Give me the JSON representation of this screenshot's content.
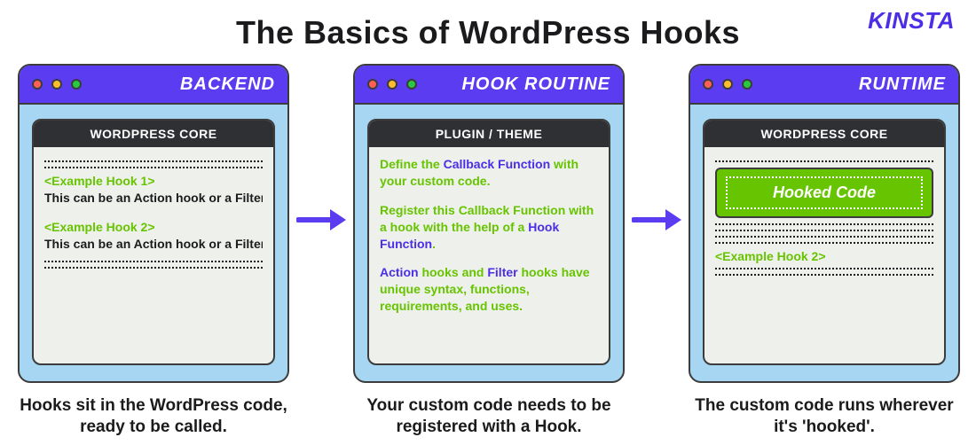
{
  "title": "The Basics of WordPress Hooks",
  "brand": "KINSTA",
  "arrow_color": "#5b3cf0",
  "dot_colors": [
    "#ff5f57",
    "#febc2e",
    "#28c840"
  ],
  "windows": [
    {
      "bar_label": "BACKEND",
      "panel_title": "WORDPRESS CORE",
      "caption": "Hooks sit in the WordPress code, ready to be called.",
      "hook1": "<Example Hook 1>",
      "hook1_desc": "This can be an Action hook or a Filter hook",
      "hook2": "<Example Hook 2>",
      "hook2_desc": "This can be an Action hook or a Filter hook"
    },
    {
      "bar_label": "HOOK ROUTINE",
      "panel_title": "PLUGIN / THEME",
      "caption": "Your custom code needs to be registered with a Hook.",
      "l1a": "Define the ",
      "l1b": "Callback Function",
      "l1c": " with your custom code.",
      "l2a": "Register this Callback Function with a hook with the help of a ",
      "l2b": "Hook Function",
      "l2c": ".",
      "l3a": "Action",
      "l3b": " hooks and ",
      "l3c": "Filter",
      "l3d": " hooks have unique syntax, functions, requirements, and uses."
    },
    {
      "bar_label": "RUNTIME",
      "panel_title": "WORDPRESS CORE",
      "caption": "The custom code runs wherever it's 'hooked'.",
      "ticket": "Hooked Code",
      "hook2": "<Example Hook 2>"
    }
  ]
}
